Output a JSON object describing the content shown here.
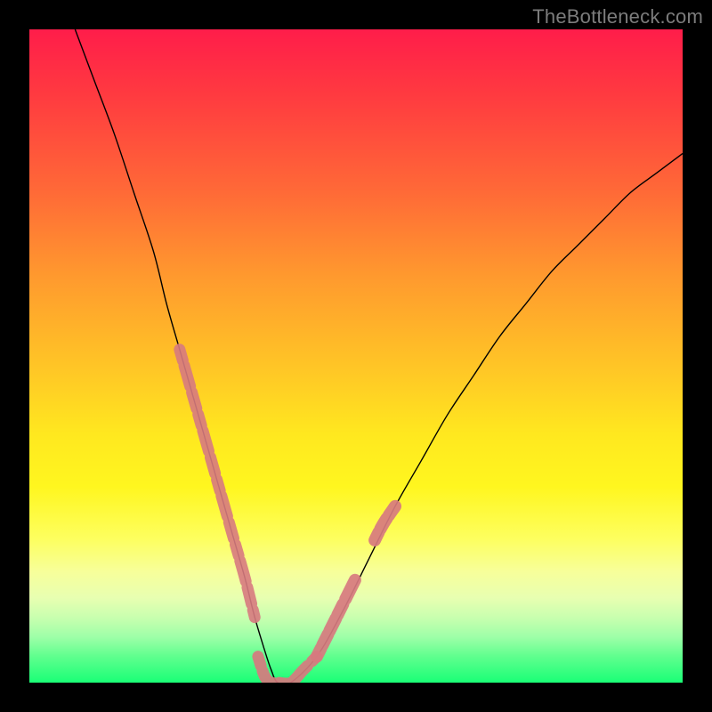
{
  "watermark": "TheBottleneck.com",
  "chart_data": {
    "type": "line",
    "title": "",
    "xlabel": "",
    "ylabel": "",
    "xlim": [
      0,
      100
    ],
    "ylim": [
      0,
      100
    ],
    "grid": false,
    "legend": false,
    "annotations": [],
    "series": [
      {
        "name": "bottleneck-curve",
        "x": [
          7,
          10,
          13,
          16,
          19,
          21,
          23,
          25,
          27,
          29,
          31,
          33,
          34.5,
          36,
          37,
          38,
          40,
          44,
          48,
          52,
          56,
          60,
          64,
          68,
          72,
          76,
          80,
          84,
          88,
          92,
          96,
          100
        ],
        "y": [
          100,
          92,
          84,
          75,
          66,
          58,
          51,
          44,
          37,
          30,
          23,
          16,
          10,
          5,
          2,
          0,
          0,
          4,
          11,
          19,
          27,
          34,
          41,
          47,
          53,
          58,
          63,
          67,
          71,
          75,
          78,
          81
        ]
      },
      {
        "name": "highlight-left",
        "x": [
          23,
          25,
          27,
          29,
          31,
          33,
          34.5
        ],
        "y": [
          51,
          44,
          37,
          30,
          23,
          16,
          10
        ]
      },
      {
        "name": "highlight-bottom",
        "x": [
          35,
          36,
          37,
          38,
          40,
          42,
          44
        ],
        "y": [
          4,
          1,
          0,
          0,
          0,
          2,
          4
        ]
      },
      {
        "name": "highlight-right",
        "x": [
          44,
          46,
          48,
          50,
          52,
          54,
          56
        ],
        "y": [
          4,
          8,
          12,
          16,
          20,
          24,
          27
        ]
      }
    ],
    "colors": {
      "curve": "#000000",
      "highlight": "#d77a7f",
      "gradient_top": "#ff1d4a",
      "gradient_bottom": "#1aff76"
    }
  }
}
